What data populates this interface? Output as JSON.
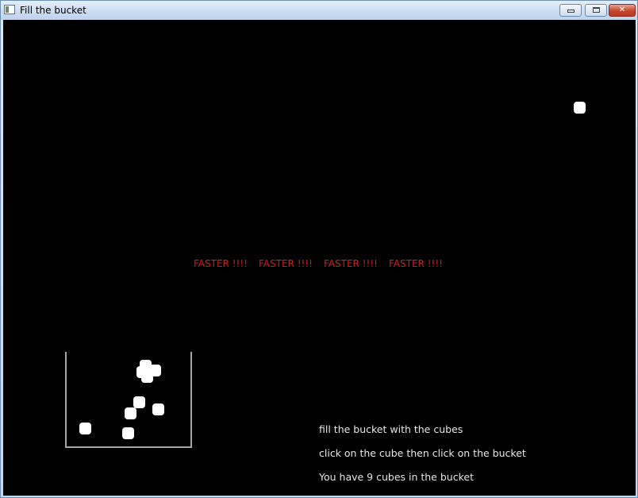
{
  "window": {
    "title": "Fill the bucket",
    "app_icon": "window-app-icon",
    "controls": {
      "minimize_icon": "minimize-icon",
      "maximize_icon": "maximize-icon",
      "close_label": "✕"
    }
  },
  "game": {
    "warnings": [
      "FASTER !!!!",
      "FASTER !!!!",
      "FASTER !!!!",
      "FASTER !!!!"
    ],
    "instructions": {
      "line1": "fill the bucket with the cubes",
      "line2": "click on the cube then click on the bucket"
    },
    "status": "You have 9 cubes in the bucket",
    "colors": {
      "background": "#000000",
      "cube": "#ffffff",
      "warning_text": "#d21c1c",
      "info_text": "#e6e6e6",
      "bucket_outline": "#a7a7a7"
    }
  }
}
